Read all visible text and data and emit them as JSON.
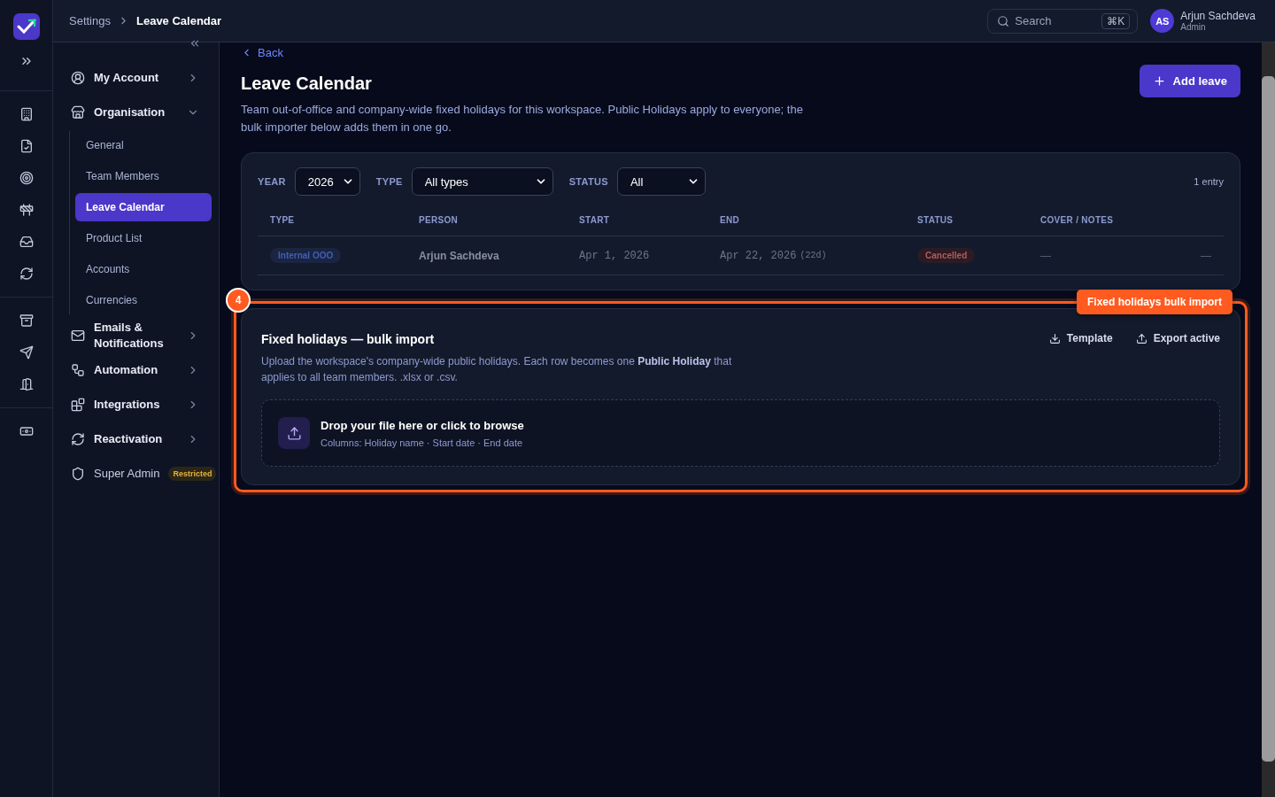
{
  "breadcrumb": [
    "Settings",
    "Leave Calendar"
  ],
  "search": {
    "placeholder": "Search",
    "shortcut": "⌘K"
  },
  "user": {
    "initials": "AS",
    "name": "Arjun Sachdeva",
    "role": "Admin"
  },
  "sidebar": {
    "items": [
      {
        "label": "My Account",
        "kind": "group",
        "expanded": false
      },
      {
        "label": "Organisation",
        "kind": "group",
        "expanded": true,
        "children": [
          {
            "label": "General",
            "selected": false
          },
          {
            "label": "Team Members",
            "selected": false
          },
          {
            "label": "Leave Calendar",
            "selected": true
          },
          {
            "label": "Product List",
            "selected": false
          },
          {
            "label": "Accounts",
            "selected": false
          },
          {
            "label": "Currencies",
            "selected": false
          }
        ]
      },
      {
        "label": "Emails & Notifications",
        "kind": "group",
        "expanded": false
      },
      {
        "label": "Automation",
        "kind": "group",
        "expanded": false
      },
      {
        "label": "Integrations",
        "kind": "group",
        "expanded": false
      },
      {
        "label": "Reactivation",
        "kind": "group",
        "expanded": false
      },
      {
        "label": "Super Admin",
        "kind": "badge",
        "badge": "Restricted"
      }
    ]
  },
  "page": {
    "back": "Back",
    "title": "Leave Calendar",
    "description": "Team out-of-office and company-wide fixed holidays for this workspace. Public Holidays apply to everyone; the bulk importer below adds them in one go.",
    "add_button": "Add leave"
  },
  "filters": [
    {
      "label": "YEAR",
      "value": "2026"
    },
    {
      "label": "TYPE",
      "value": "All types"
    },
    {
      "label": "STATUS",
      "value": "All"
    }
  ],
  "entry_count": "1 entry",
  "table": {
    "columns": [
      "TYPE",
      "PERSON",
      "START",
      "END",
      "STATUS",
      "COVER / NOTES"
    ],
    "rows": [
      {
        "type": "Internal OOO",
        "person": "Arjun Sachdeva",
        "start": "Apr 1, 2026",
        "end": "Apr 22, 2026",
        "duration": "(22d)",
        "status": "Cancelled",
        "notes": "—",
        "actions": "—",
        "dimmed": true
      }
    ]
  },
  "import": {
    "title": "Fixed holidays — bulk import",
    "description": "Upload the workspace's company-wide public holidays. Each row becomes one **Public Holiday** that applies to all team members. .xlsx or .csv.",
    "actions": [
      "Template",
      "Export active"
    ],
    "drop_title": "Drop your file here or click to browse",
    "drop_hint": "Columns: Holiday name · Start date · End date"
  },
  "annotation": {
    "number": "4",
    "label": "Fixed holidays bulk import"
  }
}
